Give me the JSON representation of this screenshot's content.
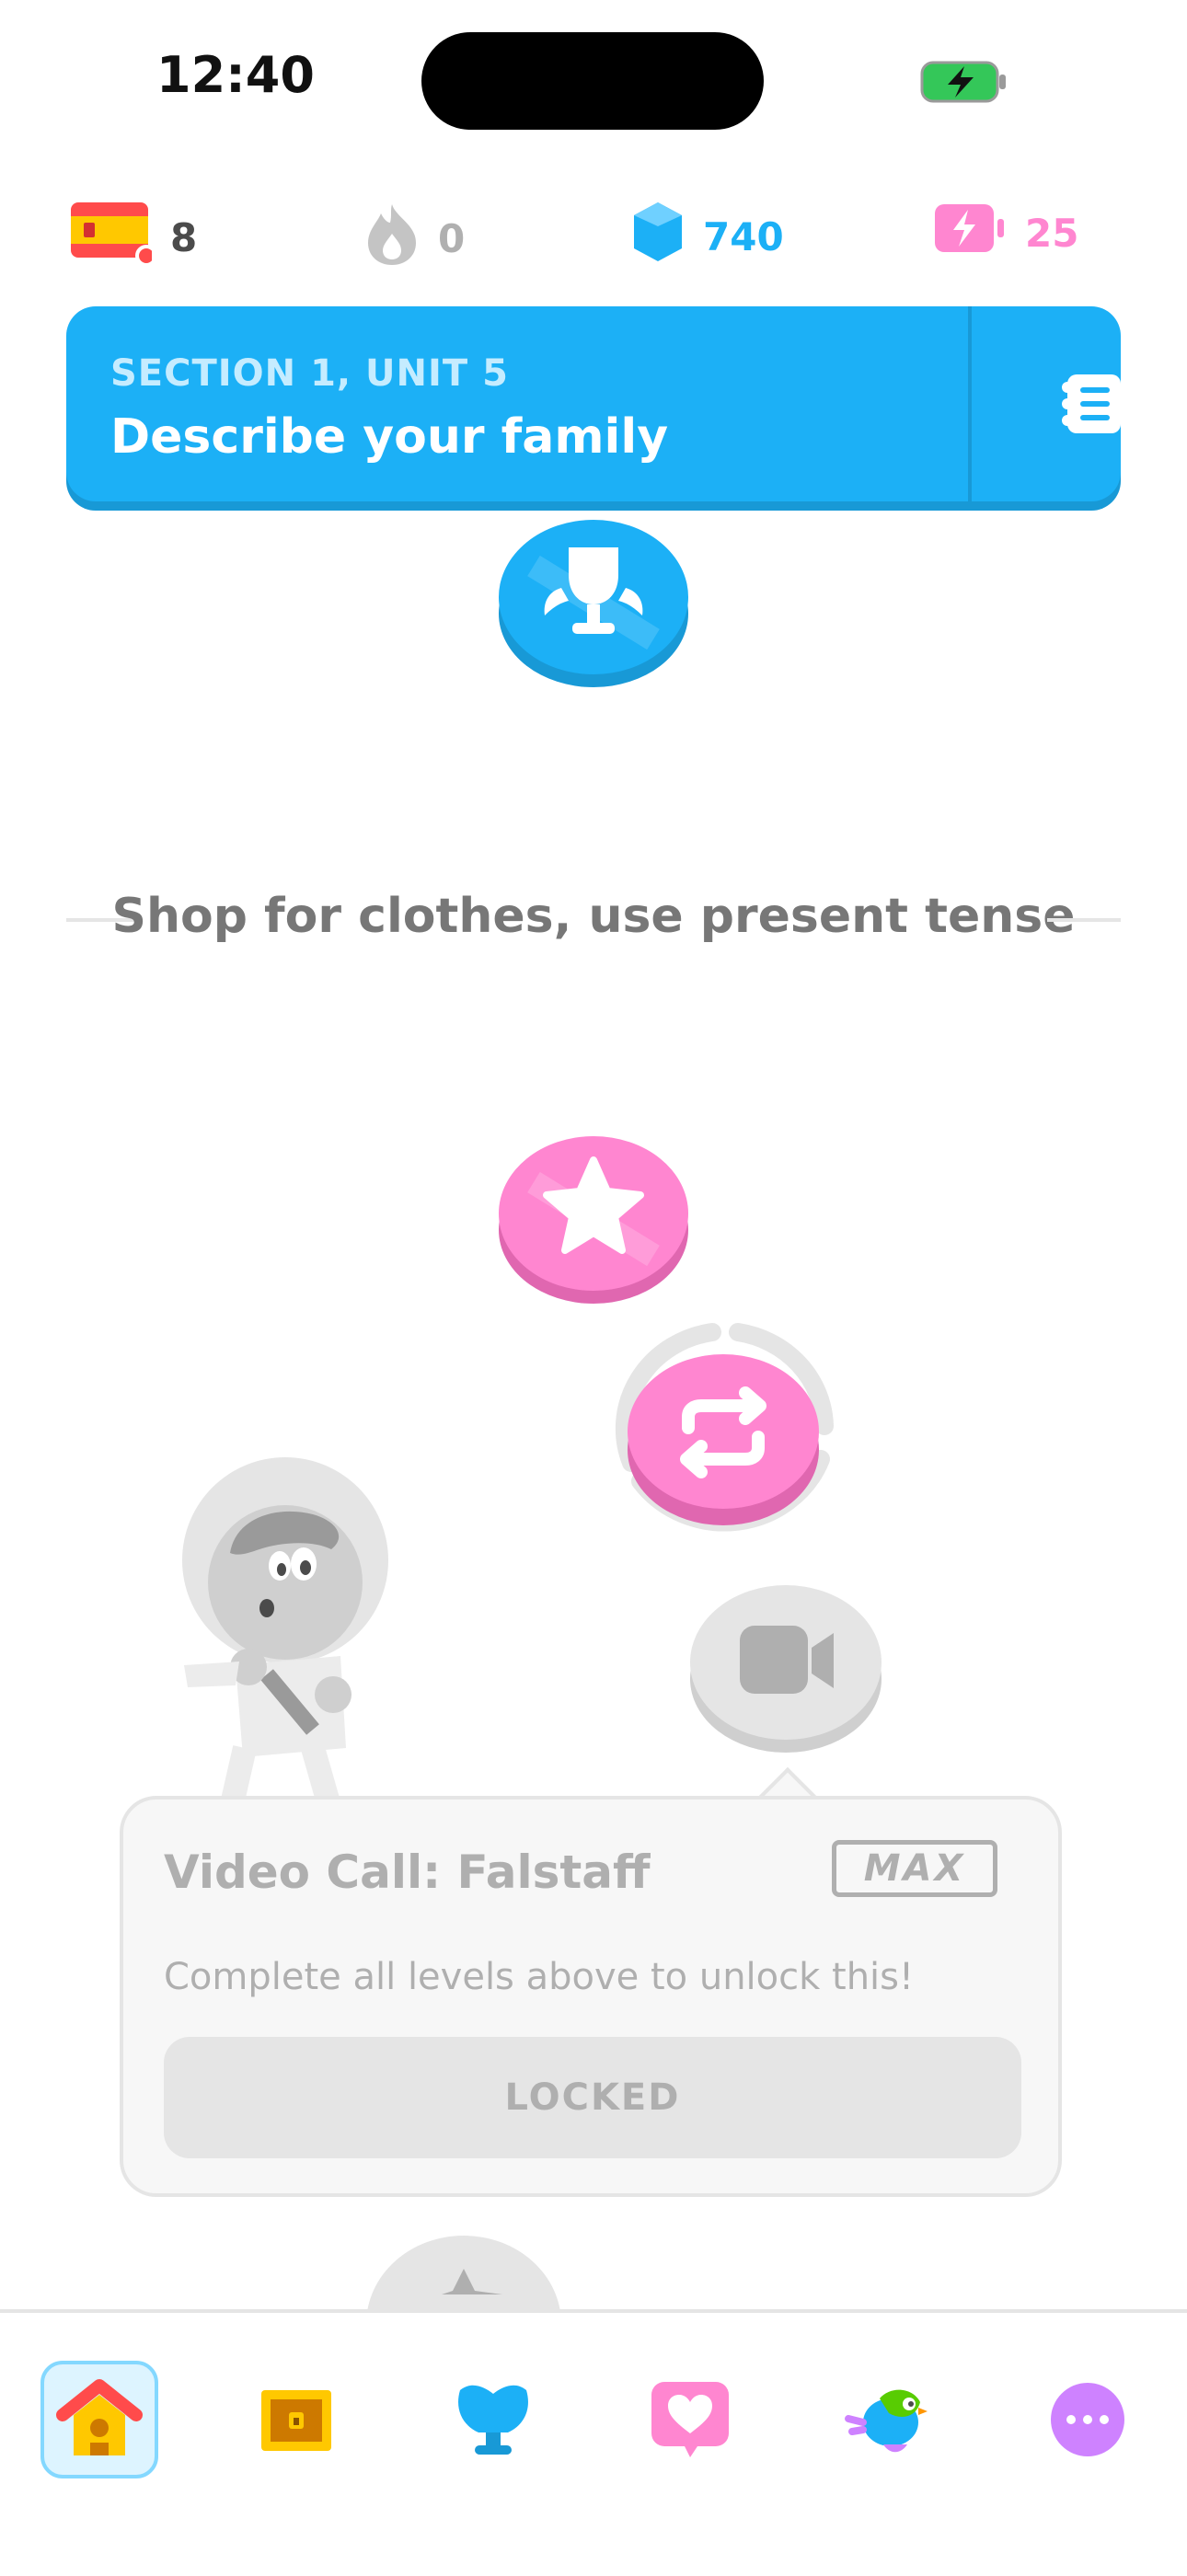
{
  "status_bar": {
    "time": "12:40"
  },
  "stats": {
    "courses_count": "8",
    "streak": "0",
    "gems": "740",
    "energy": "25"
  },
  "unit_banner": {
    "section_label": "SECTION 1, UNIT 5",
    "title": "Describe your family"
  },
  "section_divider": {
    "title": "Shop for clothes, use present tense"
  },
  "locked_popup": {
    "title": "Video Call: Falstaff",
    "badge": "MAX",
    "description": "Complete all levels above to unlock this!",
    "button_label": "LOCKED"
  },
  "colors": {
    "accent_blue": "#1cb0f6",
    "pink": "#ff86d0",
    "locked_gray": "#afafaf"
  },
  "nav": {
    "items": [
      {
        "icon": "home-icon",
        "active": true
      },
      {
        "icon": "treasure-chest-icon",
        "active": false
      },
      {
        "icon": "league-icon",
        "active": false
      },
      {
        "icon": "heart-friends-icon",
        "active": false
      },
      {
        "icon": "duo-bird-icon",
        "active": false
      },
      {
        "icon": "more-icon",
        "active": false
      }
    ]
  }
}
